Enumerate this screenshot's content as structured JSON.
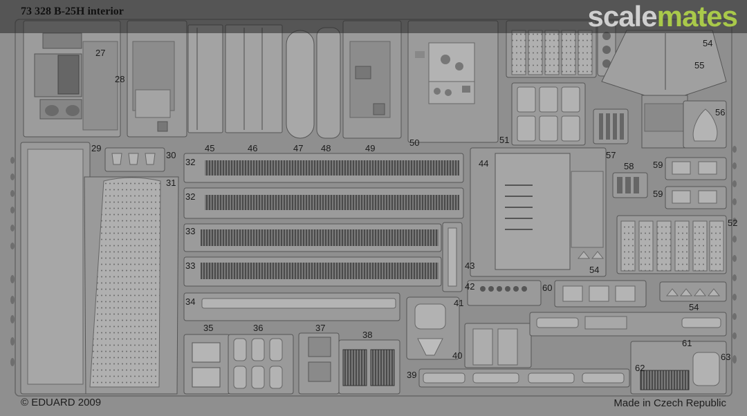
{
  "header": {
    "set_title": "73 328  B-25H interior"
  },
  "watermark": {
    "part_a": "scale",
    "part_b": "mates"
  },
  "footer": {
    "copyright": "© EDUARD 2009",
    "made_in": "Made in Czech Republic"
  },
  "part_numbers": [
    "27",
    "28",
    "29",
    "30",
    "31",
    "32",
    "32",
    "33",
    "33",
    "34",
    "35",
    "36",
    "37",
    "38",
    "39",
    "40",
    "41",
    "42",
    "43",
    "44",
    "45",
    "46",
    "47",
    "48",
    "49",
    "50",
    "51",
    "52",
    "54",
    "54",
    "54",
    "55",
    "56",
    "57",
    "58",
    "59",
    "59",
    "60",
    "61",
    "62",
    "63"
  ],
  "colors": {
    "fret_background": "#8f8f8f",
    "part_fill": "#9d9d9d",
    "part_edge": "#5a5a5a",
    "watermark_green": "#a9c94a"
  }
}
